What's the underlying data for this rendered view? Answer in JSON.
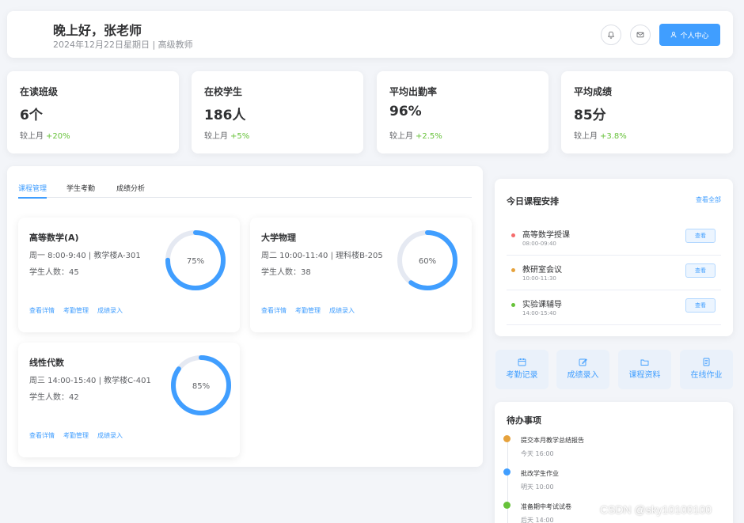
{
  "header": {
    "greeting": "晚上好，张老师",
    "subline": "2024年12月22日星期日 | 高级教师",
    "bell_icon": "bell-icon",
    "mail_icon": "mail-icon",
    "profile_label": "个人中心",
    "accent": "#409eff"
  },
  "stats": [
    {
      "label": "在读班级",
      "value": "6个",
      "compare_label": "较上月",
      "change": "+20%"
    },
    {
      "label": "在校学生",
      "value": "186人",
      "compare_label": "较上月",
      "change": "+5%"
    },
    {
      "label": "平均出勤率",
      "value": "96%",
      "compare_label": "较上月",
      "change": "+2.5%"
    },
    {
      "label": "平均成绩",
      "value": "85分",
      "compare_label": "较上月",
      "change": "+3.8%"
    }
  ],
  "tabs": [
    {
      "label": "课程管理",
      "active": true
    },
    {
      "label": "学生考勤",
      "active": false
    },
    {
      "label": "成绩分析",
      "active": false
    }
  ],
  "courses": [
    {
      "name": "高等数学(A)",
      "time": "周一 8:00-9:40 | 教学楼A-301",
      "students": "学生人数：45",
      "progress": 75,
      "progress_label": "75%"
    },
    {
      "name": "大学物理",
      "time": "周二 10:00-11:40 | 理科楼B-205",
      "students": "学生人数：38",
      "progress": 60,
      "progress_label": "60%"
    },
    {
      "name": "线性代数",
      "time": "周三 14:00-15:40 | 教学楼C-401",
      "students": "学生人数：42",
      "progress": 85,
      "progress_label": "85%"
    }
  ],
  "course_actions": [
    "查看详情",
    "考勤管理",
    "成绩录入"
  ],
  "today": {
    "title": "今日课程安排",
    "view_all": "查看全部",
    "items": [
      {
        "title": "高等数学授课",
        "time": "08:00-09:40",
        "color": "#f56c6c",
        "button": "查看"
      },
      {
        "title": "教研室会议",
        "time": "10:00-11:30",
        "color": "#e6a23c",
        "button": "查看"
      },
      {
        "title": "实验课辅导",
        "time": "14:00-15:40",
        "color": "#67c23a",
        "button": "查看"
      }
    ]
  },
  "quick_actions": [
    {
      "label": "考勤记录",
      "icon": "calendar-icon"
    },
    {
      "label": "成绩录入",
      "icon": "edit-icon"
    },
    {
      "label": "课程资料",
      "icon": "folder-icon"
    },
    {
      "label": "在线作业",
      "icon": "document-icon"
    }
  ],
  "todo": {
    "title": "待办事项",
    "items": [
      {
        "title": "提交本月教学总结报告",
        "time": "今天 16:00",
        "color": "#e6a23c"
      },
      {
        "title": "批改学生作业",
        "time": "明天 10:00",
        "color": "#409eff"
      },
      {
        "title": "准备期中考试试卷",
        "time": "后天 14:00",
        "color": "#67c23a"
      }
    ]
  },
  "watermark": "CSDN @sky10100100"
}
